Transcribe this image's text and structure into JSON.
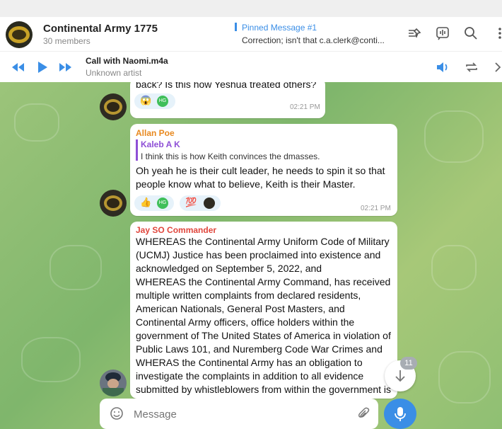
{
  "header": {
    "title": "Continental Army 1775",
    "members": "30 members",
    "pinned_title": "Pinned Message #1",
    "pinned_text": "Correction; isn't that c.a.clerk@conti...",
    "icons": [
      "pin-list-icon",
      "voice-chat-icon",
      "search-icon",
      "more-icon"
    ]
  },
  "player": {
    "title": "Call with Naomi.m4a",
    "artist": "Unknown artist",
    "icons": [
      "previous-icon",
      "play-icon",
      "next-icon",
      "volume-icon",
      "repeat-icon",
      "close-icon"
    ]
  },
  "messages": [
    {
      "text": "back? Is this how Yeshua treated others?",
      "time": "02:21 PM",
      "reactions": [
        "😱",
        "HG"
      ]
    },
    {
      "sender": "Allan Poe",
      "reply_author": "Kaleb A K",
      "reply_text": "I think this is how Keith convinces the dmasses.",
      "text": "Oh yeah he is their cult leader, he needs to spin it so that people know what to believe, Keith is their Master.",
      "time": "02:21 PM",
      "reactions": [
        "👍",
        "HG",
        "💯"
      ]
    },
    {
      "sender": "Jay SO Commander",
      "text": "WHEREAS the Continental Army Uniform Code of Military (UCMJ) Justice has been proclaimed into existence and acknowledged on September 5, 2022, and\nWHEREAS the Continental Army Command, has received multiple written complaints from declared residents, American Nationals, General Post Masters, and Continental Army officers, office holders within the government of The United States of America in violation of Public Laws 101, and Nuremberg Code War Crimes and WHERAS the Continental Army has an obligation to investigate the complaints in addition to all evidence submitted by whistleblowers from within the government is fear for their lives and"
    }
  ],
  "scroll_badge": "11",
  "input": {
    "placeholder": "Message"
  },
  "colors": {
    "accent": "#3a8ee6",
    "sender_orange": "#e8891f",
    "sender_red": "#e0463c",
    "reply_purple": "#8e4fd6"
  }
}
